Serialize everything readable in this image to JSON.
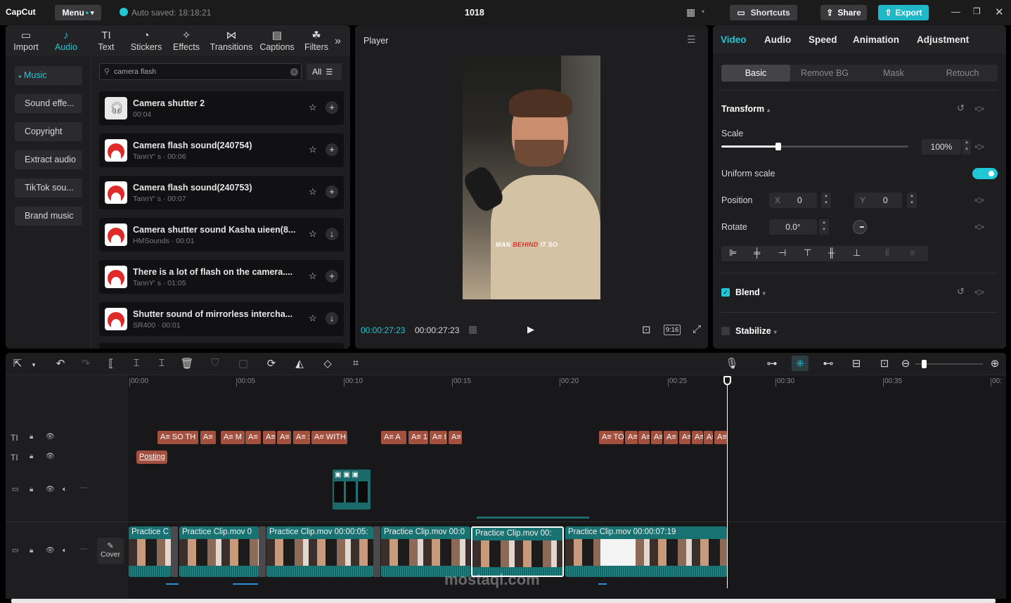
{
  "app": {
    "logo": "CapCut",
    "menu": "Menu",
    "autosave": "Auto saved: 18:18:21",
    "project": "1018",
    "shortcuts": "Shortcuts",
    "share": "Share",
    "export": "Export"
  },
  "toolbar": [
    {
      "label": "Import",
      "icon": "▭"
    },
    {
      "label": "Audio",
      "icon": "♪"
    },
    {
      "label": "Text",
      "icon": "TI"
    },
    {
      "label": "Stickers",
      "icon": "◔"
    },
    {
      "label": "Effects",
      "icon": "✧"
    },
    {
      "label": "Transitions",
      "icon": "⋈"
    },
    {
      "label": "Captions",
      "icon": "▤"
    },
    {
      "label": "Filters",
      "icon": "☘"
    }
  ],
  "categories": [
    "Music",
    "Sound effe...",
    "Copyright",
    "Extract audio",
    "TikTok sou...",
    "Brand music"
  ],
  "search": {
    "value": "camera flash",
    "filter": "All"
  },
  "sounds": [
    {
      "title": "Camera shutter 2",
      "meta": "00:04",
      "action": "+"
    },
    {
      "title": "Camera flash sound(240754)",
      "meta": "TannY'  s · 00:06",
      "action": "+"
    },
    {
      "title": "Camera flash sound(240753)",
      "meta": "TannY'  s · 00:07",
      "action": "+"
    },
    {
      "title": "Camera shutter sound Kasha uieen(8...",
      "meta": "HMSounds · 00:01",
      "action": "↓"
    },
    {
      "title": "There is a lot of flash on the camera....",
      "meta": "TannY'  s · 01:05",
      "action": "+"
    },
    {
      "title": "Shutter sound of mirrorless intercha...",
      "meta": "SR400 · 00:01",
      "action": "↓"
    }
  ],
  "player": {
    "title": "Player",
    "current": "00:00:27:23",
    "total": "00:00:27:23",
    "ratio": "9:16",
    "caption": [
      "MAN",
      "BEHIND",
      "IT SO"
    ]
  },
  "right": {
    "tabs": [
      "Video",
      "Audio",
      "Speed",
      "Animation",
      "Adjustment"
    ],
    "subtabs": [
      "Basic",
      "Remove BG",
      "Mask",
      "Retouch"
    ],
    "transform": "Transform",
    "scale_label": "Scale",
    "scale_value": "100%",
    "scale_level": 0.1,
    "uniform": "Uniform scale",
    "position": "Position",
    "x_label": "X",
    "x": "0",
    "y_label": "Y",
    "y": "0",
    "rotate": "Rotate",
    "rotate_value": "0.0°",
    "blend": "Blend",
    "stabilize": "Stabilize"
  },
  "timeline": {
    "ticks": [
      "00:00",
      "00:05",
      "00:10",
      "00:15",
      "00:20",
      "00:25",
      "00:30",
      "00:35",
      "00:"
    ],
    "text_clips": [
      "A≡ SO TH",
      "A≡",
      "A≡ M",
      "A≡",
      "A≡",
      "A≡",
      "A≡ :",
      "A≡ WITH",
      "A≡ A",
      "A≡ 1!",
      "A≡ I",
      "A≡",
      "A≡ TO",
      "A≡",
      "A≡",
      "A≡",
      "A≡",
      "A≡",
      "A≡",
      "A≡",
      "A≡"
    ],
    "posting": "Posting",
    "cover": "Cover",
    "video_clips": [
      {
        "name": "Practice C"
      },
      {
        "name": "Practice Clip.mov  0"
      },
      {
        "name": "Practice Clip.mov   00:00:05:"
      },
      {
        "name": "Practice Clip.mov   00:0"
      },
      {
        "name": "Practice Clip.mov   00:"
      },
      {
        "name": "Practice Clip.mov   00:00:07:19"
      }
    ]
  },
  "watermark": "mostaql.com",
  "colors": {
    "accent": "#20c7d6",
    "text_clip": "#a3503f",
    "video_clip": "#197272",
    "export": "#1fb8c9"
  }
}
